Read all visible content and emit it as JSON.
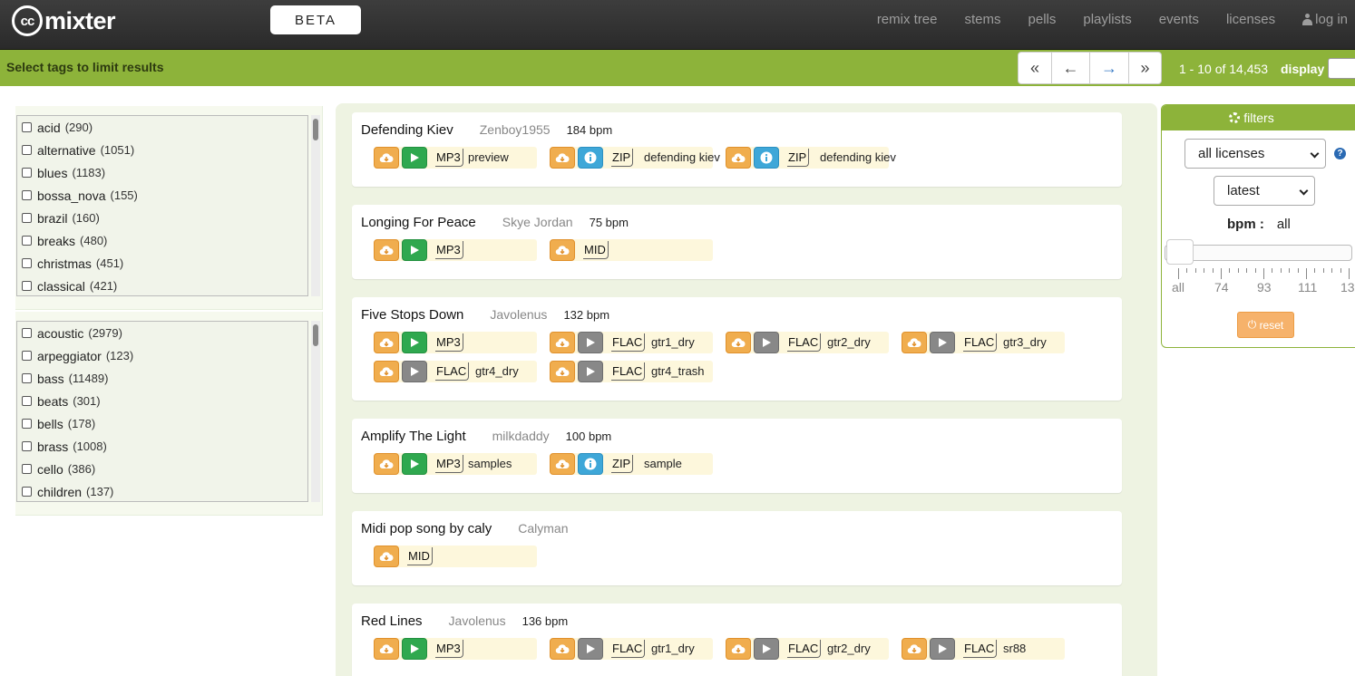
{
  "navbar": {
    "logo_mark": "cc",
    "logo_word": "mixter",
    "beta": "BETA",
    "links": [
      "remix tree",
      "stems",
      "pells",
      "playlists",
      "events",
      "licenses"
    ],
    "login": "log in"
  },
  "greenbar": {
    "title": "Select tags to limit results",
    "pager": [
      "«",
      "←",
      "→",
      "»"
    ],
    "page_info": "1 - 10 of 14,453",
    "display_label": "display"
  },
  "tag_panels": [
    [
      {
        "name": "acid",
        "count": "(290)"
      },
      {
        "name": "alternative",
        "count": "(1051)"
      },
      {
        "name": "blues",
        "count": "(1183)"
      },
      {
        "name": "bossa_nova",
        "count": "(155)"
      },
      {
        "name": "brazil",
        "count": "(160)"
      },
      {
        "name": "breaks",
        "count": "(480)"
      },
      {
        "name": "christmas",
        "count": "(451)"
      },
      {
        "name": "classical",
        "count": "(421)"
      }
    ],
    [
      {
        "name": "acoustic",
        "count": "(2979)"
      },
      {
        "name": "arpeggiator",
        "count": "(123)"
      },
      {
        "name": "bass",
        "count": "(11489)"
      },
      {
        "name": "beats",
        "count": "(301)"
      },
      {
        "name": "bells",
        "count": "(178)"
      },
      {
        "name": "brass",
        "count": "(1008)"
      },
      {
        "name": "cello",
        "count": "(386)"
      },
      {
        "name": "children",
        "count": "(137)"
      }
    ]
  ],
  "tracks": [
    {
      "title": "Defending Kiev",
      "artist": "Zenboy1955",
      "bpm": "184 bpm",
      "files": [
        {
          "type": "play",
          "fmt": "MP3",
          "name": "preview"
        },
        {
          "type": "info",
          "fmt": "ZIP",
          "name": "defending kiev"
        },
        {
          "type": "info",
          "fmt": "ZIP",
          "name": "defending kiev"
        }
      ]
    },
    {
      "title": "Longing For Peace",
      "artist": "Skye Jordan",
      "bpm": "75 bpm",
      "files": [
        {
          "type": "play",
          "fmt": "MP3",
          "name": ""
        },
        {
          "type": "none",
          "fmt": "MID",
          "name": ""
        }
      ]
    },
    {
      "title": "Five Stops Down",
      "artist": "Javolenus",
      "bpm": "132 bpm",
      "files": [
        {
          "type": "play",
          "fmt": "MP3",
          "name": ""
        },
        {
          "type": "grey",
          "fmt": "FLAC",
          "name": "gtr1_dry"
        },
        {
          "type": "grey",
          "fmt": "FLAC",
          "name": "gtr2_dry"
        },
        {
          "type": "grey",
          "fmt": "FLAC",
          "name": "gtr3_dry"
        },
        {
          "type": "grey",
          "fmt": "FLAC",
          "name": "gtr4_dry"
        },
        {
          "type": "grey",
          "fmt": "FLAC",
          "name": "gtr4_trash"
        }
      ]
    },
    {
      "title": "Amplify The Light",
      "artist": "milkdaddy",
      "bpm": "100 bpm",
      "files": [
        {
          "type": "play",
          "fmt": "MP3",
          "name": "samples"
        },
        {
          "type": "info",
          "fmt": "ZIP",
          "name": "sample"
        }
      ]
    },
    {
      "title": "Midi pop song by caly",
      "artist": "Calyman",
      "bpm": "",
      "files": [
        {
          "type": "none",
          "fmt": "MID",
          "name": ""
        }
      ]
    },
    {
      "title": "Red Lines",
      "artist": "Javolenus",
      "bpm": "136 bpm",
      "files": [
        {
          "type": "play",
          "fmt": "MP3",
          "name": ""
        },
        {
          "type": "grey",
          "fmt": "FLAC",
          "name": "gtr1_dry"
        },
        {
          "type": "grey",
          "fmt": "FLAC",
          "name": "gtr2_dry"
        },
        {
          "type": "grey",
          "fmt": "FLAC",
          "name": "sr88"
        }
      ]
    }
  ],
  "filters": {
    "title": "filters",
    "license_select": "all licenses",
    "sort_select": "latest",
    "help": "?",
    "bpm_label": "bpm :",
    "bpm_value": "all",
    "tick_labels": [
      "all",
      "74",
      "93",
      "111",
      "13"
    ],
    "reset": "reset"
  },
  "colors": {
    "navbar": "#2f2f2f",
    "green": "#8db33a",
    "download": "#f0ad4e",
    "play": "#2fa84f",
    "info": "#3ea7d8",
    "file_chip": "#fdf7dc"
  }
}
